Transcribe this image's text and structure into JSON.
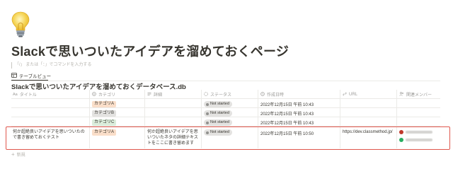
{
  "page": {
    "icon": "lightbulb-icon",
    "title": "Slackで思いついたアイデアを溜めておくページ",
    "hint": "「/」 または「：」でコマンドを入力する"
  },
  "view": {
    "tab_label": "テーブルビュー"
  },
  "database": {
    "title": "Slackで思いついたアイデアを溜めておくデータベース.db",
    "columns": [
      {
        "label": "タイトル",
        "icon": "text-icon"
      },
      {
        "label": "カテゴリ",
        "icon": "select-icon"
      },
      {
        "label": "詳細",
        "icon": "lines-icon"
      },
      {
        "label": "ステータス",
        "icon": "status-icon"
      },
      {
        "label": "作成日時",
        "icon": "clock-icon"
      },
      {
        "label": "URL",
        "icon": "link-icon"
      },
      {
        "label": "関連メンバー",
        "icon": "person-icon"
      }
    ],
    "rows": [
      {
        "title": "",
        "category": "カテゴリA",
        "detail": "",
        "status": "Not started",
        "created": "2022年12月15日 午前 10:43",
        "url": ""
      },
      {
        "title": "",
        "category": "カテゴリB",
        "detail": "",
        "status": "Not started",
        "created": "2022年12月15日 午前 10:43",
        "url": ""
      },
      {
        "title": "",
        "category": "カテゴリC",
        "detail": "",
        "status": "Not started",
        "created": "2022年12月15日 午前 10:43",
        "url": ""
      },
      {
        "title": "何か超絶良いアイデアを思いついたので書き留めておくテスト",
        "category": "カテゴリA",
        "detail": "何か超絶良いアイデアを思いついたネタの詳細テキストをここに書き留めます",
        "status": "Not started",
        "created": "2022年12月15日 午前 10:50",
        "url": "https://dev.classmethod.jp/"
      }
    ],
    "new_label": "新規"
  },
  "colors": {
    "tag_a": "#fadec9",
    "tag_b": "#e3e2e0",
    "tag_c": "#dbeddb",
    "highlight": "#e0574d",
    "avatar_red": "#c0392b",
    "avatar_green": "#27ae60"
  }
}
